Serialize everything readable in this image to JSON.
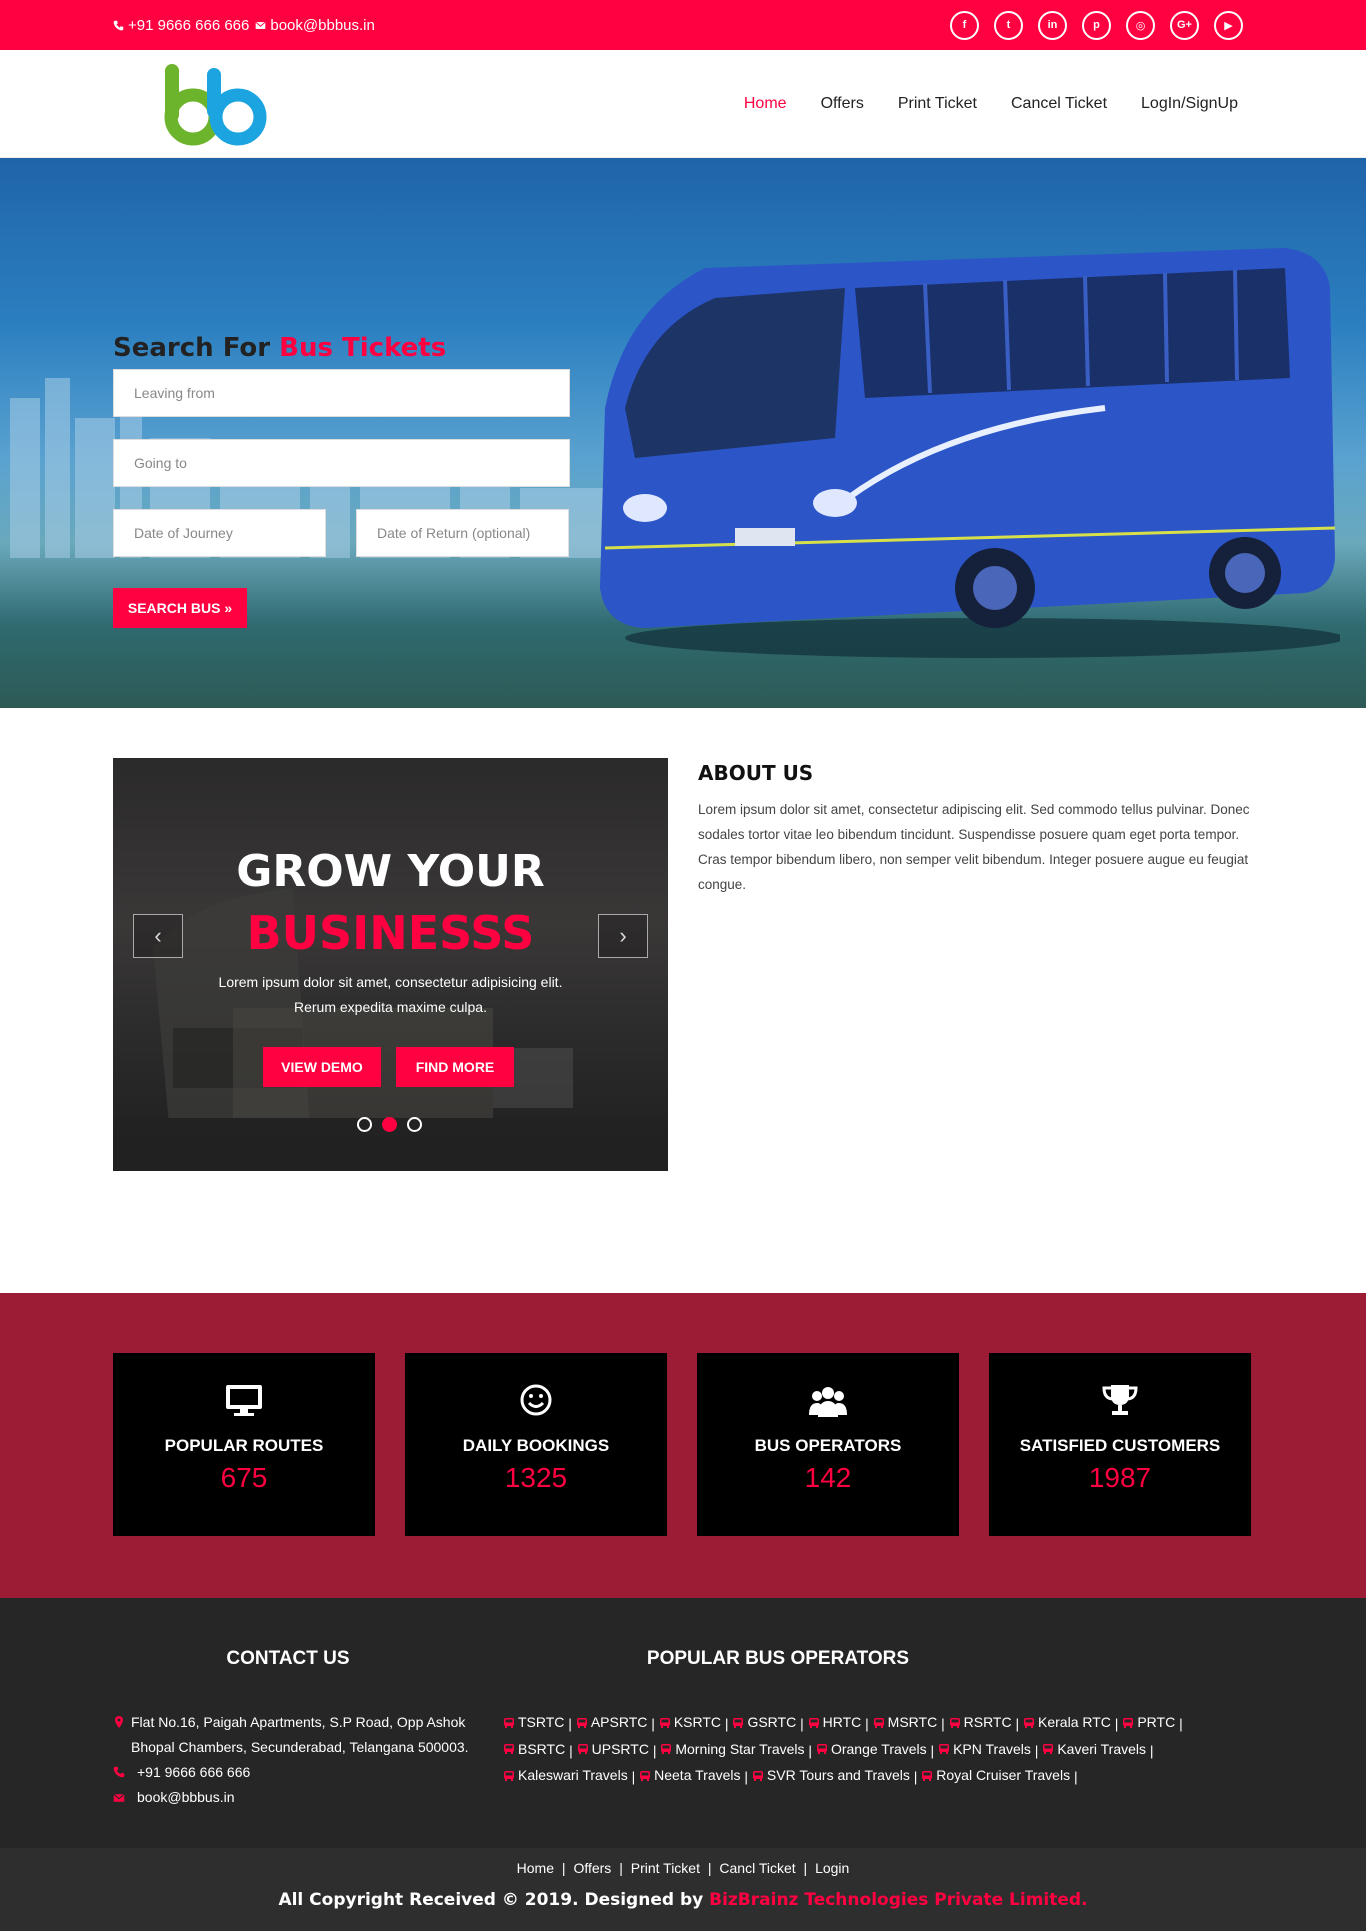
{
  "topbar": {
    "phone": "+91 9666 666 666",
    "email": "book@bbbus.in",
    "socials": [
      "facebook-icon",
      "twitter-icon",
      "linkedin-icon",
      "pinterest-icon",
      "instagram-icon",
      "google-plus-icon",
      "youtube-icon"
    ],
    "social_glyphs": [
      "f",
      "t",
      "in",
      "p",
      "◎",
      "G+",
      "▶"
    ]
  },
  "header": {
    "logo_text": "bb",
    "nav": [
      "Home",
      "Offers",
      "Print Ticket",
      "Cancel Ticket",
      "LogIn/SignUp"
    ],
    "active": "Home"
  },
  "search": {
    "title_prefix": "Search For",
    "title_highlight": "Bus Tickets",
    "leaving_placeholder": "Leaving from",
    "going_placeholder": "Going to",
    "date_placeholder": "Date of Journey",
    "return_placeholder": "Date of Return (optional)",
    "button": "SEARCH BUS »"
  },
  "slider": {
    "title1": "GROW YOUR",
    "title2": "BUSINESSS",
    "text1": "Lorem ipsum dolor sit amet, consectetur adipisicing elit.",
    "text2": "Rerum expedita maxime culpa.",
    "btn1": "VIEW DEMO",
    "btn2": "FIND MORE",
    "active_dot": 2
  },
  "about": {
    "heading": "ABOUT US",
    "body": "Lorem ipsum dolor sit amet, consectetur adipiscing elit. Sed commodo tellus pulvinar. Donec sodales tortor vitae leo bibendum tincidunt. Suspendisse posuere quam eget porta tempor. Cras tempor bibendum libero, non semper velit bibendum. Integer posuere augue eu feugiat congue."
  },
  "stats": [
    {
      "icon": "monitor-icon",
      "label": "POPULAR ROUTES",
      "value": "675"
    },
    {
      "icon": "smiley-icon",
      "label": "DAILY BOOKINGS",
      "value": "1325"
    },
    {
      "icon": "users-icon",
      "label": "BUS OPERATORS",
      "value": "142"
    },
    {
      "icon": "trophy-icon",
      "label": "SATISFIED CUSTOMERS",
      "value": "1987"
    }
  ],
  "footer": {
    "contact_heading": "CONTACT US",
    "address": "Flat No.16, Paigah Apartments, S.P Road, Opp Ashok Bhopal Chambers, Secunderabad, Telangana 500003.",
    "phone": "+91 9666 666 666",
    "email": "book@bbbus.in",
    "operators_heading": "POPULAR BUS OPERATORS",
    "operators": [
      "TSRTC",
      "APSRTC",
      "KSRTC",
      "GSRTC",
      "HRTC",
      "MSRTC",
      "RSRTC",
      "Kerala RTC",
      "PRTC",
      "BSRTC",
      "UPSRTC",
      "Morning Star Travels",
      "Orange Travels",
      "KPN Travels",
      "Kaveri Travels",
      "Kaleswari Travels",
      "Neeta Travels",
      "SVR Tours and Travels",
      "Royal Cruiser Travels"
    ]
  },
  "bottom": {
    "links": [
      "Home",
      "Offers",
      "Print Ticket",
      "Cancl Ticket",
      "Login"
    ],
    "copy_prefix": "All Copyright Received © 2019. Designed by",
    "copy_company": "BizBrainz Technologies Private Limited."
  },
  "colors": {
    "accent": "#ff0040",
    "stats_bg": "#9c1c36",
    "footer_bg": "#262626"
  }
}
